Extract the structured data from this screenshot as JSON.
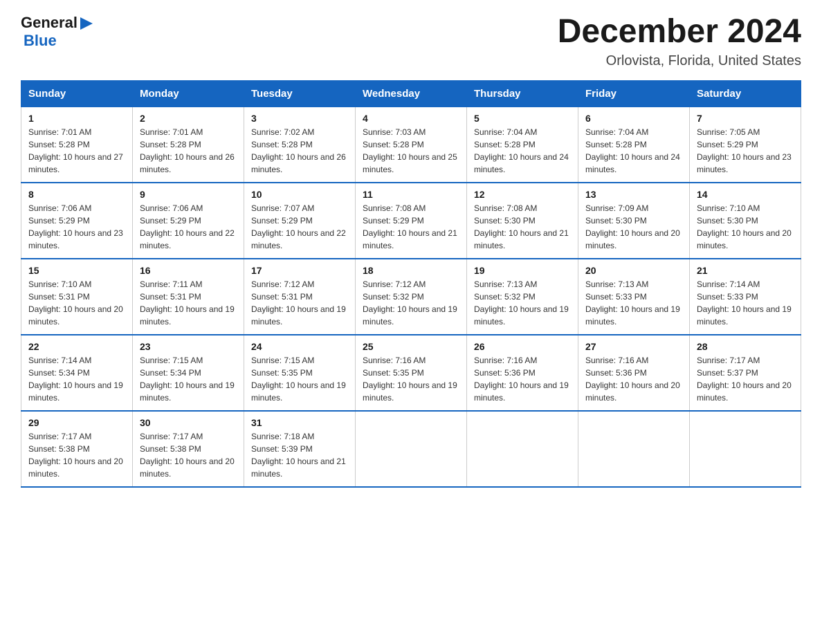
{
  "header": {
    "logo_general": "General",
    "logo_blue": "Blue",
    "title": "December 2024",
    "subtitle": "Orlovista, Florida, United States"
  },
  "days_of_week": [
    "Sunday",
    "Monday",
    "Tuesday",
    "Wednesday",
    "Thursday",
    "Friday",
    "Saturday"
  ],
  "weeks": [
    [
      {
        "day": "1",
        "sunrise": "7:01 AM",
        "sunset": "5:28 PM",
        "daylight": "10 hours and 27 minutes."
      },
      {
        "day": "2",
        "sunrise": "7:01 AM",
        "sunset": "5:28 PM",
        "daylight": "10 hours and 26 minutes."
      },
      {
        "day": "3",
        "sunrise": "7:02 AM",
        "sunset": "5:28 PM",
        "daylight": "10 hours and 26 minutes."
      },
      {
        "day": "4",
        "sunrise": "7:03 AM",
        "sunset": "5:28 PM",
        "daylight": "10 hours and 25 minutes."
      },
      {
        "day": "5",
        "sunrise": "7:04 AM",
        "sunset": "5:28 PM",
        "daylight": "10 hours and 24 minutes."
      },
      {
        "day": "6",
        "sunrise": "7:04 AM",
        "sunset": "5:28 PM",
        "daylight": "10 hours and 24 minutes."
      },
      {
        "day": "7",
        "sunrise": "7:05 AM",
        "sunset": "5:29 PM",
        "daylight": "10 hours and 23 minutes."
      }
    ],
    [
      {
        "day": "8",
        "sunrise": "7:06 AM",
        "sunset": "5:29 PM",
        "daylight": "10 hours and 23 minutes."
      },
      {
        "day": "9",
        "sunrise": "7:06 AM",
        "sunset": "5:29 PM",
        "daylight": "10 hours and 22 minutes."
      },
      {
        "day": "10",
        "sunrise": "7:07 AM",
        "sunset": "5:29 PM",
        "daylight": "10 hours and 22 minutes."
      },
      {
        "day": "11",
        "sunrise": "7:08 AM",
        "sunset": "5:29 PM",
        "daylight": "10 hours and 21 minutes."
      },
      {
        "day": "12",
        "sunrise": "7:08 AM",
        "sunset": "5:30 PM",
        "daylight": "10 hours and 21 minutes."
      },
      {
        "day": "13",
        "sunrise": "7:09 AM",
        "sunset": "5:30 PM",
        "daylight": "10 hours and 20 minutes."
      },
      {
        "day": "14",
        "sunrise": "7:10 AM",
        "sunset": "5:30 PM",
        "daylight": "10 hours and 20 minutes."
      }
    ],
    [
      {
        "day": "15",
        "sunrise": "7:10 AM",
        "sunset": "5:31 PM",
        "daylight": "10 hours and 20 minutes."
      },
      {
        "day": "16",
        "sunrise": "7:11 AM",
        "sunset": "5:31 PM",
        "daylight": "10 hours and 19 minutes."
      },
      {
        "day": "17",
        "sunrise": "7:12 AM",
        "sunset": "5:31 PM",
        "daylight": "10 hours and 19 minutes."
      },
      {
        "day": "18",
        "sunrise": "7:12 AM",
        "sunset": "5:32 PM",
        "daylight": "10 hours and 19 minutes."
      },
      {
        "day": "19",
        "sunrise": "7:13 AM",
        "sunset": "5:32 PM",
        "daylight": "10 hours and 19 minutes."
      },
      {
        "day": "20",
        "sunrise": "7:13 AM",
        "sunset": "5:33 PM",
        "daylight": "10 hours and 19 minutes."
      },
      {
        "day": "21",
        "sunrise": "7:14 AM",
        "sunset": "5:33 PM",
        "daylight": "10 hours and 19 minutes."
      }
    ],
    [
      {
        "day": "22",
        "sunrise": "7:14 AM",
        "sunset": "5:34 PM",
        "daylight": "10 hours and 19 minutes."
      },
      {
        "day": "23",
        "sunrise": "7:15 AM",
        "sunset": "5:34 PM",
        "daylight": "10 hours and 19 minutes."
      },
      {
        "day": "24",
        "sunrise": "7:15 AM",
        "sunset": "5:35 PM",
        "daylight": "10 hours and 19 minutes."
      },
      {
        "day": "25",
        "sunrise": "7:16 AM",
        "sunset": "5:35 PM",
        "daylight": "10 hours and 19 minutes."
      },
      {
        "day": "26",
        "sunrise": "7:16 AM",
        "sunset": "5:36 PM",
        "daylight": "10 hours and 19 minutes."
      },
      {
        "day": "27",
        "sunrise": "7:16 AM",
        "sunset": "5:36 PM",
        "daylight": "10 hours and 20 minutes."
      },
      {
        "day": "28",
        "sunrise": "7:17 AM",
        "sunset": "5:37 PM",
        "daylight": "10 hours and 20 minutes."
      }
    ],
    [
      {
        "day": "29",
        "sunrise": "7:17 AM",
        "sunset": "5:38 PM",
        "daylight": "10 hours and 20 minutes."
      },
      {
        "day": "30",
        "sunrise": "7:17 AM",
        "sunset": "5:38 PM",
        "daylight": "10 hours and 20 minutes."
      },
      {
        "day": "31",
        "sunrise": "7:18 AM",
        "sunset": "5:39 PM",
        "daylight": "10 hours and 21 minutes."
      },
      {
        "day": "",
        "sunrise": "",
        "sunset": "",
        "daylight": ""
      },
      {
        "day": "",
        "sunrise": "",
        "sunset": "",
        "daylight": ""
      },
      {
        "day": "",
        "sunrise": "",
        "sunset": "",
        "daylight": ""
      },
      {
        "day": "",
        "sunrise": "",
        "sunset": "",
        "daylight": ""
      }
    ]
  ],
  "colors": {
    "header_bg": "#1565c0",
    "border": "#1565c0",
    "text_main": "#1a1a1a",
    "text_info": "#333333"
  }
}
